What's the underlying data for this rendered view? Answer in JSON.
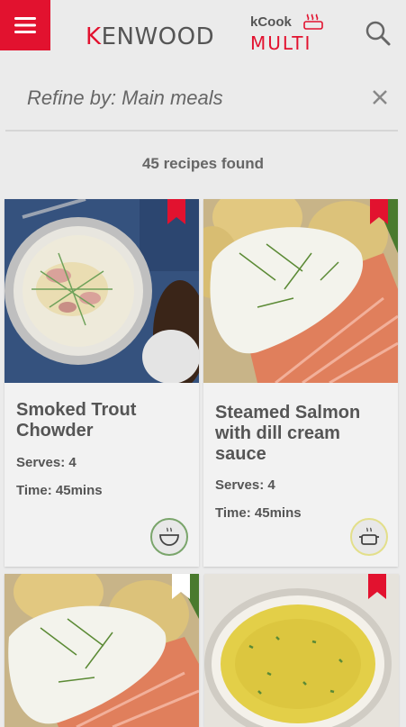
{
  "header": {
    "brand_k": "K",
    "brand_rest": "ENWOOD",
    "kcook_top": "kCook",
    "kcook_bottom": "MULTI"
  },
  "filter": {
    "label": "Refine by: Main meals"
  },
  "results": {
    "count_text": "45 recipes found"
  },
  "recipes": [
    {
      "title": "Smoked Trout Chowder",
      "serves": "Serves: 4",
      "time": "Time: 45mins",
      "bookmarked": true,
      "cook_icon_ring": "#7aa56b"
    },
    {
      "title": "Steamed Salmon with dill cream sauce",
      "serves": "Serves: 4",
      "time": "Time: 45mins",
      "bookmarked": true,
      "cook_icon_ring": "#e3df8a"
    },
    {
      "title": "",
      "bookmarked": false
    },
    {
      "title": "",
      "bookmarked": true
    }
  ],
  "colors": {
    "accent": "#e2122f",
    "background": "#ebebeb",
    "text": "#555555"
  },
  "icons": {
    "menu": "hamburger-icon",
    "search": "search-icon",
    "clear": "close-icon",
    "bookmark": "bookmark-icon",
    "cook_mode": "pot-icon"
  }
}
